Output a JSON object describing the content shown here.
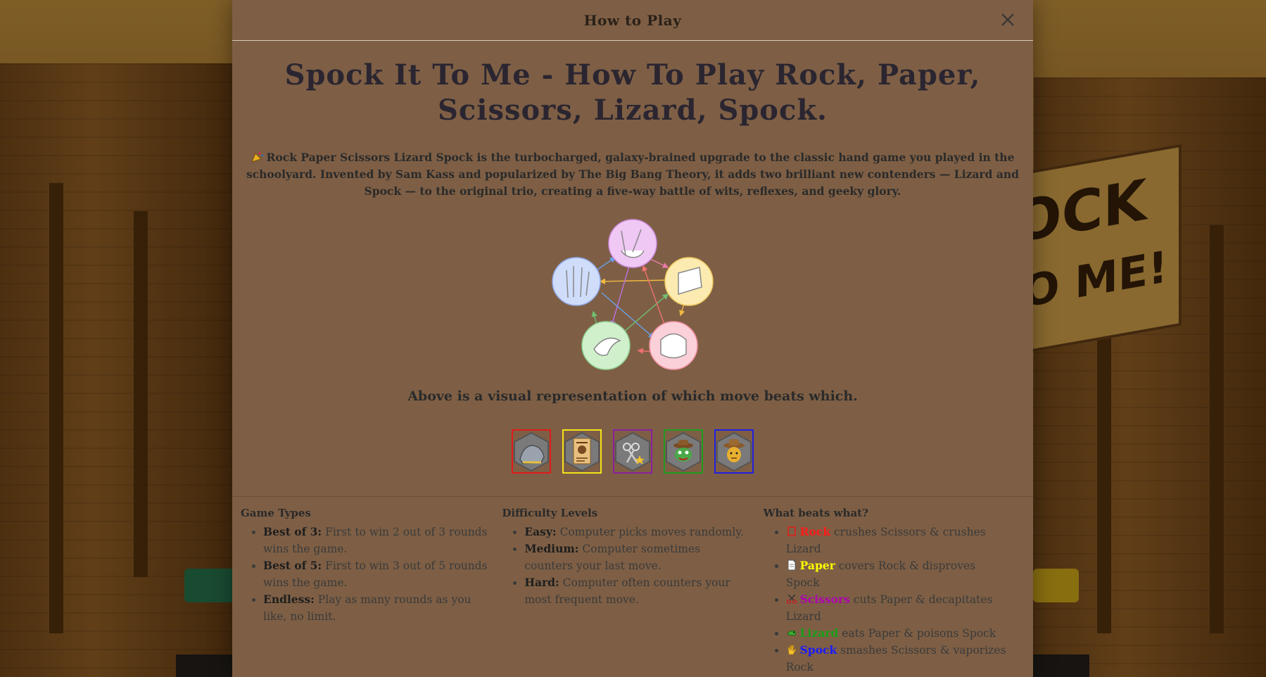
{
  "modal": {
    "header_title": "How to Play",
    "main_title": "Spock It To Me - How To Play Rock, Paper, Scissors, Lizard, Spock.",
    "intro": "Rock Paper Scissors Lizard Spock is the turbocharged, galaxy-brained upgrade to the classic hand game you played in the schoolyard. Invented by Sam Kass and popularized by The Big Bang Theory, it adds two brilliant new contenders — Lizard and Spock — to the original trio, creating a five-way battle of wits, reflexes, and geeky glory.",
    "caption": "Above is a visual representation of which move beats which."
  },
  "tiles": [
    {
      "name": "rock",
      "border": "#e01b1b"
    },
    {
      "name": "paper",
      "border": "#f5e31a"
    },
    {
      "name": "scissors",
      "border": "#8b1fa0"
    },
    {
      "name": "lizard",
      "border": "#1f9c1f"
    },
    {
      "name": "spock",
      "border": "#2020e0"
    }
  ],
  "game_types": {
    "heading": "Game Types",
    "items": [
      {
        "label": "Best of 3:",
        "text": " First to win 2 out of 3 rounds wins the game."
      },
      {
        "label": "Best of 5:",
        "text": " First to win 3 out of 5 rounds wins the game."
      },
      {
        "label": "Endless:",
        "text": " Play as many rounds as you like, no limit."
      }
    ]
  },
  "difficulty": {
    "heading": "Difficulty Levels",
    "items": [
      {
        "label": "Easy:",
        "text": " Computer picks moves randomly."
      },
      {
        "label": "Medium:",
        "text": " Computer sometimes counters your last move."
      },
      {
        "label": "Hard:",
        "text": " Computer often counters your most frequent move."
      }
    ]
  },
  "beats": {
    "heading": "What beats what?",
    "items": [
      {
        "move": "Rock",
        "color": "#ff1a1a",
        "text": " crushes Scissors & crushes Lizard"
      },
      {
        "move": "Paper",
        "color": "#ffff00",
        "text": " covers Rock & disproves Spock"
      },
      {
        "move": "Scissors",
        "color": "#b000b0",
        "text": " cuts Paper & decapitates Lizard"
      },
      {
        "move": "Lizard",
        "color": "#18a018",
        "text": " eats Paper & poisons Spock"
      },
      {
        "move": "Spock",
        "color": "#1a1aff",
        "text": " smashes Scissors & vaporizes Rock"
      }
    ]
  },
  "background": {
    "sign_line1": "OCK",
    "sign_line2": "TO ME!"
  }
}
